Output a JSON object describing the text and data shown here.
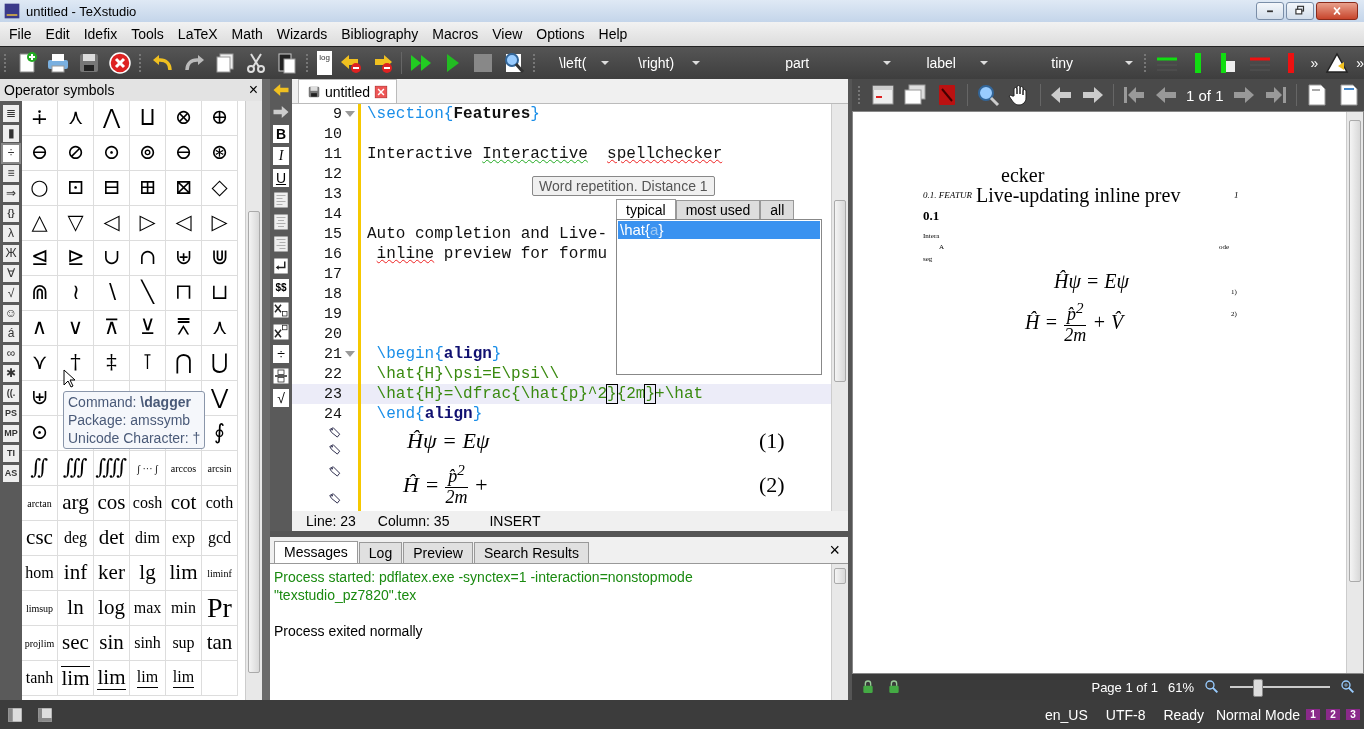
{
  "window": {
    "title": "untitled - TeXstudio"
  },
  "menu": [
    "File",
    "Edit",
    "Idefix",
    "Tools",
    "LaTeX",
    "Math",
    "Wizards",
    "Bibliography",
    "Macros",
    "View",
    "Options",
    "Help"
  ],
  "toolbar": {
    "log_label": "log",
    "dropdowns": [
      "\\left(",
      "\\right)",
      "part",
      "label",
      "tiny"
    ],
    "overflow": [
      "»",
      "»"
    ]
  },
  "symbols_panel": {
    "title": "Operator symbols",
    "close": "×",
    "categories": [
      {
        "label": "≣",
        "selected": false
      },
      {
        "label": "▮",
        "selected": false
      },
      {
        "label": "÷",
        "selected": true
      },
      {
        "label": "≡",
        "selected": false
      },
      {
        "label": "⇒",
        "selected": false
      },
      {
        "label": "{}",
        "selected": false
      },
      {
        "label": "λ",
        "selected": false
      },
      {
        "label": "Ж",
        "selected": false
      },
      {
        "label": "∀",
        "selected": false
      },
      {
        "label": "√",
        "selected": false
      },
      {
        "label": "☺",
        "selected": false
      },
      {
        "label": "á",
        "selected": false
      },
      {
        "label": "∞",
        "selected": false
      },
      {
        "label": "✱",
        "selected": false
      },
      {
        "label": "((.",
        "selected": false
      },
      {
        "label": "PS",
        "selected": false
      },
      {
        "label": "MP",
        "selected": false
      },
      {
        "label": "TI",
        "selected": false
      },
      {
        "label": "AS",
        "selected": false
      }
    ],
    "rows": [
      [
        {
          "kind": "sym",
          "text": "∔"
        },
        {
          "kind": "sym",
          "text": "⋏"
        },
        {
          "kind": "sym",
          "text": "⋀"
        },
        {
          "kind": "sym",
          "text": "⨿"
        },
        {
          "kind": "sym",
          "text": "⊗"
        },
        {
          "kind": "sym",
          "text": "⊕"
        }
      ],
      [
        {
          "kind": "sym",
          "text": "⊖"
        },
        {
          "kind": "sym",
          "text": "⊘"
        },
        {
          "kind": "sym",
          "text": "⊙"
        },
        {
          "kind": "sym",
          "text": "⊚"
        },
        {
          "kind": "sym",
          "text": "⊖"
        },
        {
          "kind": "sym",
          "text": "⊛"
        }
      ],
      [
        {
          "kind": "sym",
          "text": "○"
        },
        {
          "kind": "sym",
          "text": "⊡"
        },
        {
          "kind": "sym",
          "text": "⊟"
        },
        {
          "kind": "sym",
          "text": "⊞"
        },
        {
          "kind": "sym",
          "text": "⊠"
        },
        {
          "kind": "sym",
          "text": "◇"
        }
      ],
      [
        {
          "kind": "sym",
          "text": "△"
        },
        {
          "kind": "sym",
          "text": "▽"
        },
        {
          "kind": "sym",
          "text": "◁"
        },
        {
          "kind": "sym",
          "text": "▷"
        },
        {
          "kind": "sym",
          "text": "◁"
        },
        {
          "kind": "sym",
          "text": "▷"
        }
      ],
      [
        {
          "kind": "sym",
          "text": "⊴"
        },
        {
          "kind": "sym",
          "text": "⊵"
        },
        {
          "kind": "sym",
          "text": "∪"
        },
        {
          "kind": "sym",
          "text": "∩"
        },
        {
          "kind": "sym",
          "text": "⊎"
        },
        {
          "kind": "sym",
          "text": "⋓"
        }
      ],
      [
        {
          "kind": "sym",
          "text": "⋒"
        },
        {
          "kind": "sym",
          "text": "≀"
        },
        {
          "kind": "sym",
          "text": "∖"
        },
        {
          "kind": "sym",
          "text": "╲"
        },
        {
          "kind": "sym",
          "text": "⊓"
        },
        {
          "kind": "sym",
          "text": "⊔"
        }
      ],
      [
        {
          "kind": "sym",
          "text": "∧"
        },
        {
          "kind": "sym",
          "text": "∨"
        },
        {
          "kind": "sym",
          "text": "⊼"
        },
        {
          "kind": "sym",
          "text": "⊻"
        },
        {
          "kind": "sym",
          "text": "⩞"
        },
        {
          "kind": "sym",
          "text": "⋏"
        }
      ],
      [
        {
          "kind": "sym",
          "text": "⋎"
        },
        {
          "kind": "sym",
          "text": "†"
        },
        {
          "kind": "sym",
          "text": "‡"
        },
        {
          "kind": "sym",
          "text": "⊺"
        },
        {
          "kind": "sym",
          "text": "⋂"
        },
        {
          "kind": "sym",
          "text": "⋃"
        }
      ],
      [
        {
          "kind": "sym",
          "text": "⊎"
        },
        {
          "kind": "blank"
        },
        {
          "kind": "blank"
        },
        {
          "kind": "blank"
        },
        {
          "kind": "blank"
        },
        {
          "kind": "sym",
          "text": "⋁"
        }
      ],
      [
        {
          "kind": "sym",
          "text": "⊙"
        },
        {
          "kind": "blank"
        },
        {
          "kind": "blank"
        },
        {
          "kind": "blank"
        },
        {
          "kind": "blank"
        },
        {
          "kind": "sym",
          "text": "∮"
        }
      ],
      [
        {
          "kind": "sym",
          "text": "∬"
        },
        {
          "kind": "sym",
          "text": "∭"
        },
        {
          "kind": "sym",
          "text": "⨌"
        },
        {
          "kind": "small",
          "text": "∫ ··· ∫"
        },
        {
          "kind": "small",
          "text": "arccos"
        },
        {
          "kind": "small",
          "text": "arcsin"
        }
      ],
      [
        {
          "kind": "small",
          "text": "arctan"
        },
        {
          "kind": "word",
          "text": "arg"
        },
        {
          "kind": "word",
          "text": "cos"
        },
        {
          "kind": "mid",
          "text": "cosh"
        },
        {
          "kind": "word",
          "text": "cot"
        },
        {
          "kind": "mid",
          "text": "coth"
        }
      ],
      [
        {
          "kind": "word",
          "text": "csc"
        },
        {
          "kind": "mid",
          "text": "deg"
        },
        {
          "kind": "word",
          "text": "det"
        },
        {
          "kind": "mid",
          "text": "dim"
        },
        {
          "kind": "mid",
          "text": "exp"
        },
        {
          "kind": "mid",
          "text": "gcd"
        }
      ],
      [
        {
          "kind": "mid",
          "text": "hom"
        },
        {
          "kind": "word",
          "text": "inf"
        },
        {
          "kind": "word",
          "text": "ker"
        },
        {
          "kind": "word",
          "text": "lg"
        },
        {
          "kind": "word",
          "text": "lim"
        },
        {
          "kind": "small",
          "text": "liminf"
        }
      ],
      [
        {
          "kind": "small",
          "text": "limsup"
        },
        {
          "kind": "word",
          "text": "ln"
        },
        {
          "kind": "word",
          "text": "log"
        },
        {
          "kind": "mid",
          "text": "max"
        },
        {
          "kind": "mid",
          "text": "min"
        },
        {
          "kind": "big",
          "text": "Pr"
        }
      ],
      [
        {
          "kind": "small",
          "text": "projlim"
        },
        {
          "kind": "word",
          "text": "sec"
        },
        {
          "kind": "word",
          "text": "sin"
        },
        {
          "kind": "mid",
          "text": "sinh"
        },
        {
          "kind": "mid",
          "text": "sup"
        },
        {
          "kind": "word",
          "text": "tan"
        }
      ],
      [
        {
          "kind": "mid",
          "text": "tanh"
        },
        {
          "kind": "over",
          "text": "lim"
        },
        {
          "kind": "under",
          "text": "lim"
        },
        {
          "kind": "right",
          "text": "lim"
        },
        {
          "kind": "left",
          "text": "lim"
        },
        {
          "kind": "blank"
        }
      ]
    ],
    "tooltip": [
      "Command: **\\dagger**",
      "Package: amssymb",
      "Unicode Character: †"
    ]
  },
  "format_tools": [
    "B",
    "I",
    "U",
    "$$",
    "÷",
    "√"
  ],
  "editor": {
    "tab": "untitled",
    "lines": [
      {
        "number": "9",
        "fold": true,
        "current": false,
        "tokens": [
          {
            "text": "\\section",
            "kind": "cmd"
          },
          {
            "text": "{",
            "kind": "brace"
          },
          {
            "text": "Features",
            "kind": "arg"
          },
          {
            "text": "}",
            "kind": "brace"
          }
        ]
      },
      {
        "number": "10",
        "fold": false,
        "current": false
      },
      {
        "number": "11",
        "fold": false,
        "current": false,
        "tokens": [
          {
            "text": "Interactive ",
            "kind": "text"
          },
          {
            "text": "Interactive",
            "kind": "repeat"
          },
          {
            "text": "  spellchecker",
            "kind": "misspelled"
          }
        ]
      },
      {
        "number": "12",
        "fold": false,
        "current": false
      },
      {
        "number": "13",
        "fold": false,
        "current": false
      },
      {
        "number": "14",
        "fold": false,
        "current": false
      },
      {
        "number": "15",
        "fold": false,
        "current": false,
        "tokens": [
          {
            "text": "Auto completion and Live-",
            "kind": "text"
          }
        ]
      },
      {
        "number": "16",
        "fold": false,
        "current": false,
        "tokens": [
          {
            "text": " inline",
            "kind": "misspelled"
          },
          {
            "text": " preview for formu",
            "kind": "text"
          }
        ]
      },
      {
        "number": "17",
        "fold": false,
        "current": false
      },
      {
        "number": "18",
        "fold": false,
        "current": false
      },
      {
        "number": "19",
        "fold": false,
        "current": false
      },
      {
        "number": "20",
        "fold": false,
        "current": false
      },
      {
        "number": "21",
        "fold": true,
        "current": false,
        "tokens": [
          {
            "text": " \\begin",
            "kind": "cmd"
          },
          {
            "text": "{",
            "kind": "brace"
          },
          {
            "text": "align",
            "kind": "arg"
          },
          {
            "text": "}",
            "kind": "brace"
          }
        ]
      },
      {
        "number": "22",
        "fold": false,
        "current": false,
        "tokens": [
          {
            "text": " \\hat{H}\\psi=E\\psi\\\\",
            "kind": "math"
          }
        ]
      },
      {
        "number": "23",
        "fold": false,
        "current": true,
        "tokens": [
          {
            "text": " \\hat{H}=\\dfrac{\\hat{p}^2",
            "kind": "math"
          },
          {
            "text": "}",
            "kind": "match"
          },
          {
            "text": "{2m",
            "kind": "math"
          },
          {
            "text": "}",
            "kind": "match"
          },
          {
            "text": "+\\hat",
            "kind": "math"
          }
        ]
      },
      {
        "number": "24",
        "fold": false,
        "current": false,
        "tokens": [
          {
            "text": " \\end",
            "kind": "cmd"
          },
          {
            "text": "{",
            "kind": "brace"
          },
          {
            "text": "align",
            "kind": "arg"
          },
          {
            "text": "}",
            "kind": "brace"
          }
        ]
      }
    ],
    "previews": [
      {
        "kind": "inline",
        "math": "Ĥψ = Eψ",
        "number": "(1)"
      },
      {
        "kind": "fraction",
        "before": "Ĥ =",
        "numerator": "p̂$^{2}$",
        "denominator": "2m",
        "after": "+",
        "number": "(2)"
      }
    ],
    "hint": "Word repetition. Distance 1",
    "completion": {
      "tabs": [
        {
          "label": "typical",
          "selected": true
        },
        {
          "label": "most used",
          "selected": false
        },
        {
          "label": "all",
          "selected": false
        }
      ],
      "items": [
        {
          "selected": true,
          "tokens": [
            {
              "text": "\\hat{",
              "kind": "plain"
            },
            {
              "text": "a",
              "kind": "faded"
            },
            {
              "text": "}",
              "kind": "plain"
            }
          ]
        }
      ]
    },
    "status": {
      "line": "Line: 23",
      "column": "Column: 35",
      "mode": "INSERT"
    }
  },
  "messages": {
    "tabs": [
      {
        "label": "Messages",
        "selected": true
      },
      {
        "label": "Log",
        "selected": false
      },
      {
        "label": "Preview",
        "selected": false
      },
      {
        "label": "Search Results",
        "selected": false
      }
    ],
    "close": "×",
    "lines": [
      {
        "kind": "info",
        "text": "Process started: pdflatex.exe -synctex=1 -interaction=nonstopmode"
      },
      {
        "kind": "info",
        "text": "\"texstudio_pz7820\".tex"
      },
      {
        "kind": "blank"
      },
      {
        "kind": "normal",
        "text": "Process exited normally"
      }
    ]
  },
  "pdf": {
    "page_indicator": "1 of 1",
    "fragments": [
      {
        "kind": "large",
        "text": "ecker"
      },
      {
        "kind": "header",
        "text": "0.1.  FEATUR"
      },
      {
        "kind": "large",
        "text": "Live-updating inline prev"
      },
      {
        "kind": "header",
        "text": "1"
      },
      {
        "kind": "heading",
        "text": "0.1"
      },
      {
        "kind": "tiny",
        "text": "Intera"
      },
      {
        "kind": "tiny",
        "text": "A"
      },
      {
        "kind": "tiny",
        "text": "ode"
      },
      {
        "kind": "tiny",
        "text": "seg"
      },
      {
        "kind": "eq",
        "text": "Ĥψ = Eψ"
      },
      {
        "kind": "tiny",
        "text": "1)"
      },
      {
        "kind": "tiny",
        "text": "2)"
      }
    ],
    "equation": {
      "before": "Ĥ =",
      "numerator": "p̂$^{2}$",
      "denominator": "2m",
      "after": "+ V̂"
    },
    "status": {
      "page": "Page 1 of 1",
      "zoom": "61%",
      "level": 0.27
    }
  },
  "status_bar": {
    "items": [
      "en_US",
      "UTF-8"
    ],
    "ready": "Ready",
    "mode": "Normal Mode",
    "bookmarks": [
      "1",
      "2",
      "3"
    ]
  }
}
